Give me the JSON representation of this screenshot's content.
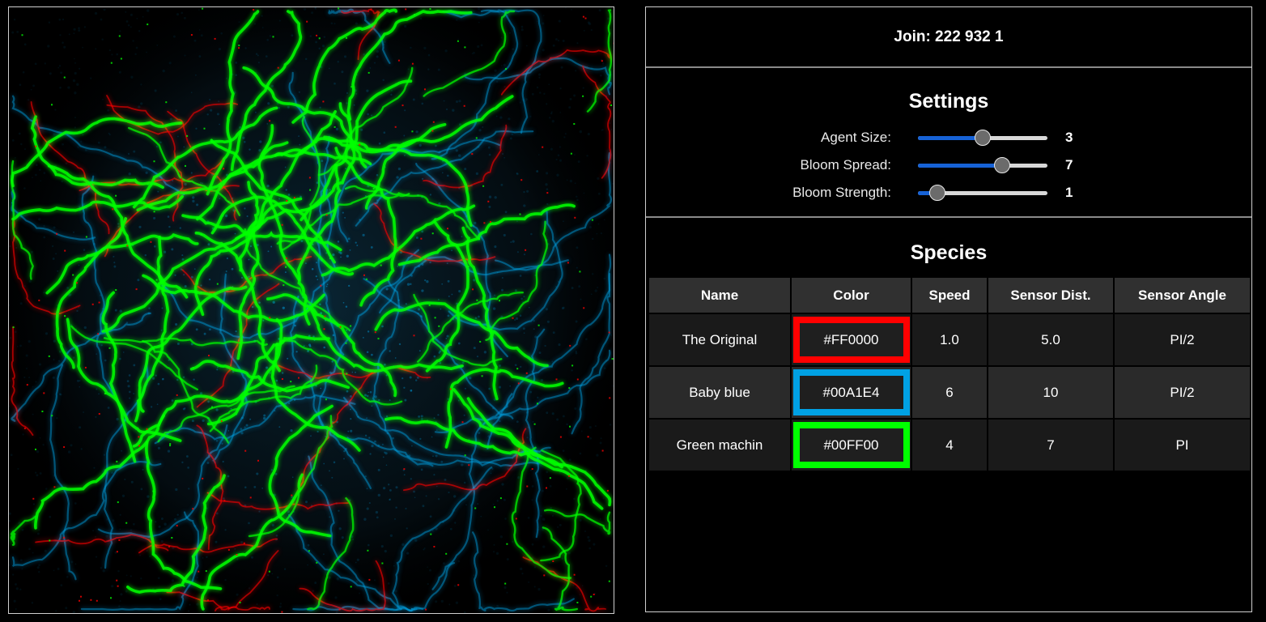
{
  "join": {
    "label": "Join: 222 932 1"
  },
  "settings": {
    "title": "Settings",
    "sliders": [
      {
        "label": "Agent Size:",
        "value": "3",
        "fraction": 0.5
      },
      {
        "label": "Bloom Spread:",
        "value": "7",
        "fraction": 0.65
      },
      {
        "label": "Bloom Strength:",
        "value": "1",
        "fraction": 0.15
      }
    ],
    "track_color": "#d8d8d8",
    "fill_color": "#1662d6"
  },
  "species": {
    "title": "Species",
    "columns": [
      "Name",
      "Color",
      "Speed",
      "Sensor Dist.",
      "Sensor Angle"
    ],
    "rows": [
      {
        "name": "The Original",
        "color": "#FF0000",
        "speed": "1.0",
        "sensor_dist": "5.0",
        "sensor_angle": "PI/2"
      },
      {
        "name": "Baby blue",
        "color": "#00A1E4",
        "speed": "6",
        "sensor_dist": "10",
        "sensor_angle": "PI/2"
      },
      {
        "name": "Green machin",
        "color": "#00FF00",
        "speed": "4",
        "sensor_dist": "7",
        "sensor_angle": "PI"
      }
    ]
  },
  "simulation": {
    "colors": [
      "#FF0000",
      "#00A1E4",
      "#00FF00"
    ]
  }
}
